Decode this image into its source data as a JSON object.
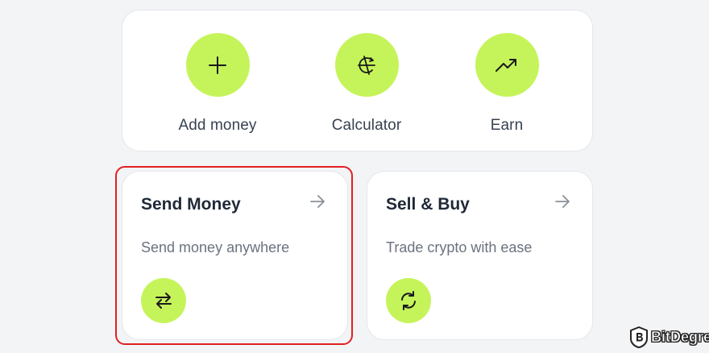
{
  "quick_actions": [
    {
      "label": "Add money",
      "icon": "plus-icon"
    },
    {
      "label": "Calculator",
      "icon": "calculator-icon"
    },
    {
      "label": "Earn",
      "icon": "trend-up-icon"
    }
  ],
  "send_card": {
    "title": "Send Money",
    "subtitle": "Send money anywhere",
    "icon": "transfer-arrows-icon",
    "arrow_icon": "arrow-right-icon",
    "highlighted": true
  },
  "sell_card": {
    "title": "Sell & Buy",
    "subtitle": "Trade crypto with ease",
    "icon": "refresh-icon",
    "arrow_icon": "arrow-right-icon"
  },
  "watermark": {
    "text": "BitDegree"
  },
  "colors": {
    "accent": "#c5f45a",
    "highlight": "#e02020",
    "background": "#f3f4f6",
    "card": "#ffffff",
    "title": "#1f2937",
    "subtitle": "#6b7280"
  }
}
